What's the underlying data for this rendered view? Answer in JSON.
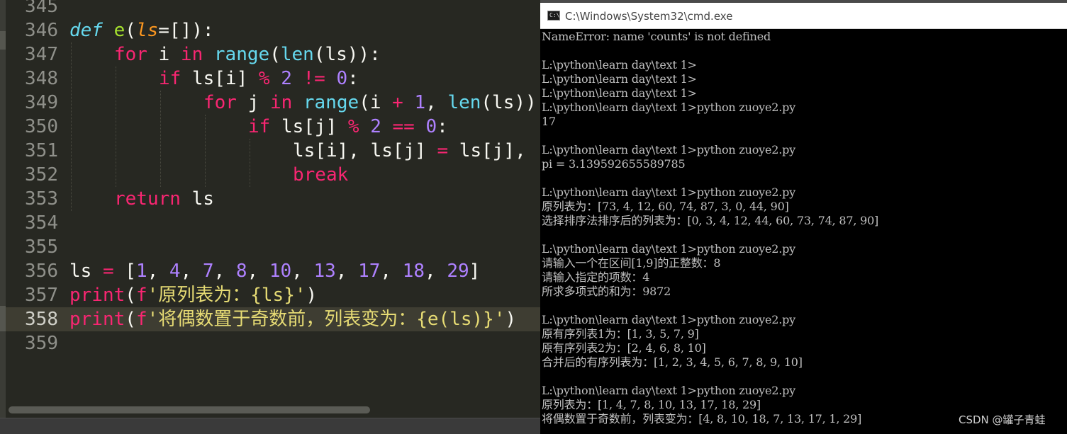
{
  "editor": {
    "line_numbers": [
      "345",
      "346",
      "347",
      "348",
      "349",
      "350",
      "351",
      "352",
      "353",
      "354",
      "355",
      "356",
      "357",
      "358",
      "359"
    ],
    "current_line": "358",
    "tokens": {
      "l346": [
        "def",
        " ",
        "e",
        "(",
        "ls",
        "=[]):"
      ],
      "l347": [
        "for",
        " i ",
        "in",
        " ",
        "range",
        "(",
        "len",
        "(ls)):"
      ],
      "l348": [
        "if",
        " ls[i] ",
        "%",
        " ",
        "2",
        " ",
        "!=",
        " ",
        "0",
        ":"
      ],
      "l349": [
        "for",
        " j ",
        "in",
        " ",
        "range",
        "(i ",
        "+",
        " ",
        "1",
        ", ",
        "len",
        "(ls))"
      ],
      "l350": [
        "if",
        " ls[j] ",
        "%",
        " ",
        "2",
        " ",
        "==",
        " ",
        "0",
        ":"
      ],
      "l351": [
        "ls[i], ls[j] ",
        "=",
        " ls[j],"
      ],
      "l352": [
        "break"
      ],
      "l353": [
        "return",
        " ls"
      ],
      "l356": [
        "ls ",
        "=",
        " [",
        "1",
        ", ",
        "4",
        ", ",
        "7",
        ", ",
        "8",
        ", ",
        "10",
        ", ",
        "13",
        ", ",
        "17",
        ", ",
        "18",
        ", ",
        "29",
        "]"
      ],
      "l357": [
        "print",
        "(",
        "f",
        "'原列表为：{ls}'",
        ")"
      ],
      "l358": [
        "print",
        "(",
        "f",
        "'将偶数置于奇数前，列表变为：{e(ls)}'",
        ")"
      ]
    }
  },
  "console": {
    "title": "C:\\Windows\\System32\\cmd.exe",
    "lines": [
      "NameError: name 'counts' is not defined",
      "",
      "L:\\python\\learn day\\text 1>",
      "L:\\python\\learn day\\text 1>",
      "L:\\python\\learn day\\text 1>",
      "L:\\python\\learn day\\text 1>python zuoye2.py",
      "17",
      "",
      "L:\\python\\learn day\\text 1>python zuoye2.py",
      "pi = 3.139592655589785",
      "",
      "L:\\python\\learn day\\text 1>python zuoye2.py",
      "原列表为：[73, 4, 12, 60, 74, 87, 3, 0, 44, 90]",
      "选择排序法排序后的列表为：[0, 3, 4, 12, 44, 60, 73, 74, 87, 90]",
      "",
      "L:\\python\\learn day\\text 1>python zuoye2.py",
      "请输入一个在区间[1,9]的正整数：8",
      "请输入指定的项数：4",
      "所求多项式的和为：9872",
      "",
      "L:\\python\\learn day\\text 1>python zuoye2.py",
      "原有序列表1为：[1, 3, 5, 7, 9]",
      "原有序列表2为：[2, 4, 6, 8, 10]",
      "合并后的有序列表为：[1, 2, 3, 4, 5, 6, 7, 8, 9, 10]",
      "",
      "L:\\python\\learn day\\text 1>python zuoye2.py",
      "原列表为：[1, 4, 7, 8, 10, 13, 17, 18, 29]",
      "将偶数置于奇数前，列表变为：[4, 8, 10, 18, 7, 13, 17, 1, 29]"
    ]
  },
  "watermark": "CSDN @罐子青蛙",
  "colors": {
    "editor_bg": "#272822",
    "keyword": "#f92672",
    "function": "#a6e22e",
    "builtin": "#66d9ef",
    "number": "#ae81ff",
    "string": "#e6db74",
    "parameter": "#fd971f",
    "console_bg": "#000000",
    "console_text": "#c0c0c0"
  },
  "icons": {
    "console": "cmd-window-icon"
  }
}
